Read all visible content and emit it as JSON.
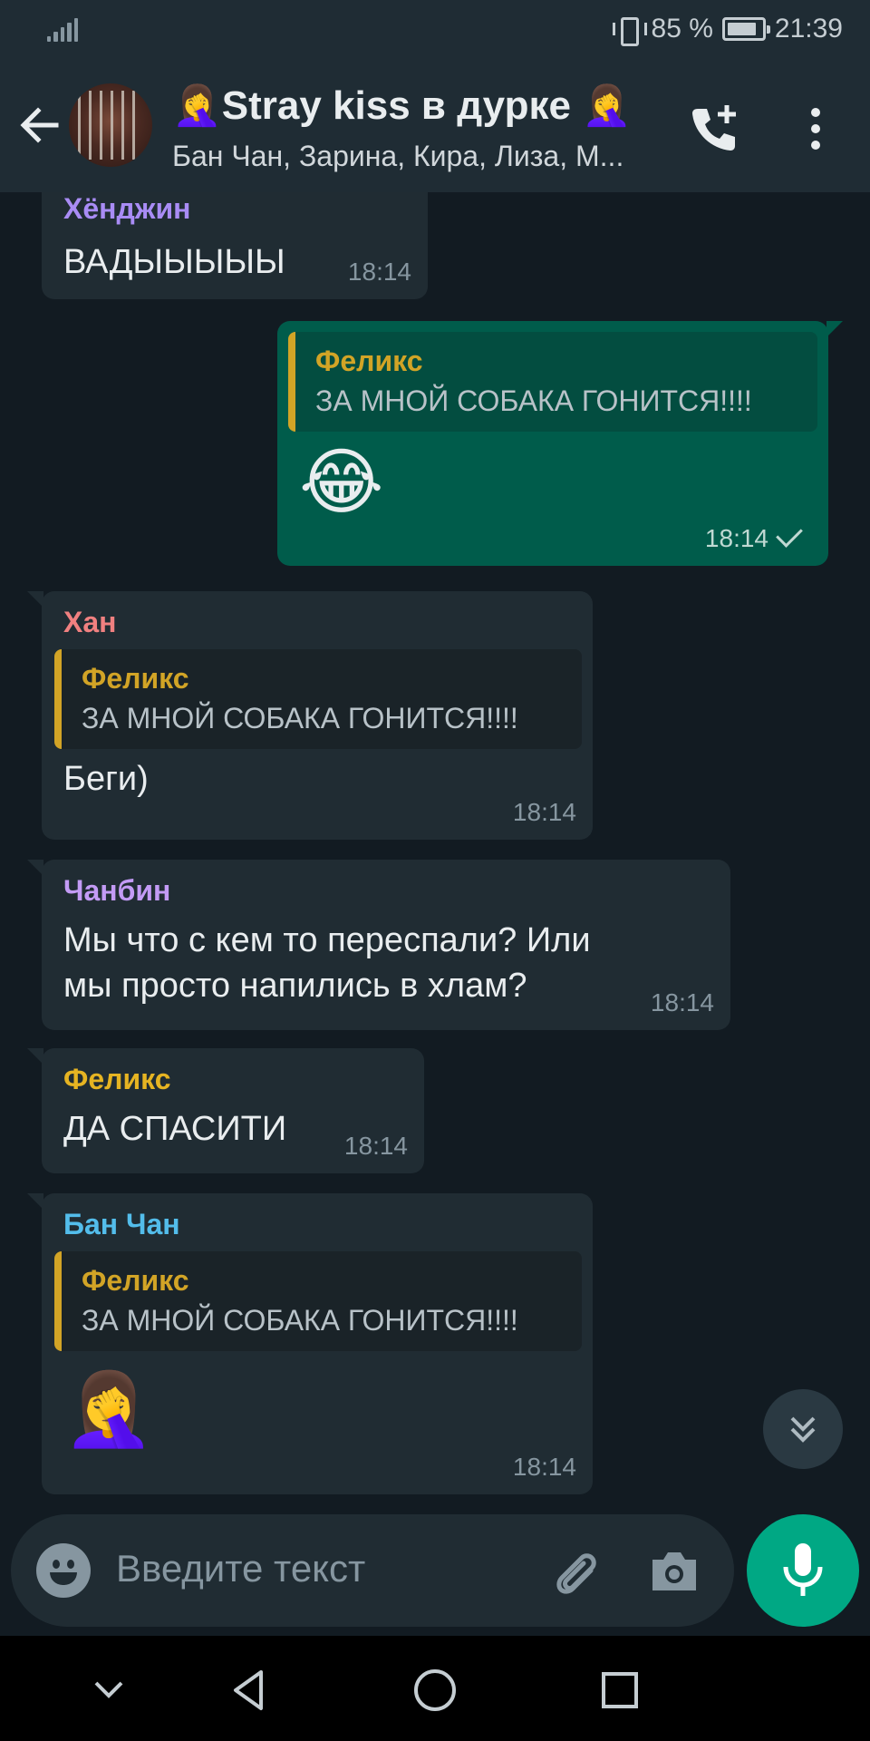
{
  "status_bar": {
    "battery_text": "85 %",
    "battery_level": 0.85,
    "time": "21:39"
  },
  "header": {
    "title": "🤦‍♀️Stray kiss в дурке 🤦‍♀️",
    "subtitle": "Бан Чан, Зарина, Кира, Лиза, М..."
  },
  "messages": [
    {
      "sender": "Хёнджин",
      "sender_color": "#a98cf5",
      "text": "ВАДЫЫЫЫЫ",
      "time": "18:14"
    },
    {
      "outgoing": true,
      "quote_name": "Феликс",
      "quote_text": "ЗА МНОЙ СОБАКА ГОНИТСЯ!!!!",
      "emoji": "😂",
      "time": "18:14"
    },
    {
      "sender": "Хан",
      "sender_color": "#f08080",
      "quote_name": "Феликс",
      "quote_text": "ЗА МНОЙ СОБАКА ГОНИТСЯ!!!!",
      "text": "Беги)",
      "time": "18:14"
    },
    {
      "sender": "Чанбин",
      "sender_color": "#c39bf5",
      "text_line1": "Мы что с кем то переспали? Или",
      "text_line2": "мы просто напились в хлам?",
      "time": "18:14"
    },
    {
      "sender": "Феликс",
      "sender_color": "#e6b422",
      "text": "ДА СПАСИТИ",
      "time": "18:14"
    },
    {
      "sender": "Бан Чан",
      "sender_color": "#53bdeb",
      "quote_name": "Феликс",
      "quote_text": "ЗА МНОЙ СОБАКА ГОНИТСЯ!!!!",
      "emoji": "🤦‍♀️",
      "time": "18:14"
    }
  ],
  "composer": {
    "placeholder": "Введите текст"
  },
  "colors": {
    "background": "#121b22",
    "bar": "#1f2c34",
    "incoming_bubble": "#202c33",
    "outgoing_bubble": "#005c4b",
    "quote_accent": "#d2a426",
    "accent": "#00a884"
  },
  "icons": {
    "back": "arrow-left-icon",
    "call": "add-call-icon",
    "menu": "more-vert-icon",
    "emoji": "emoji-icon",
    "attach": "paperclip-icon",
    "camera": "camera-icon",
    "mic": "microphone-icon",
    "scroll": "double-chevron-down-icon"
  }
}
